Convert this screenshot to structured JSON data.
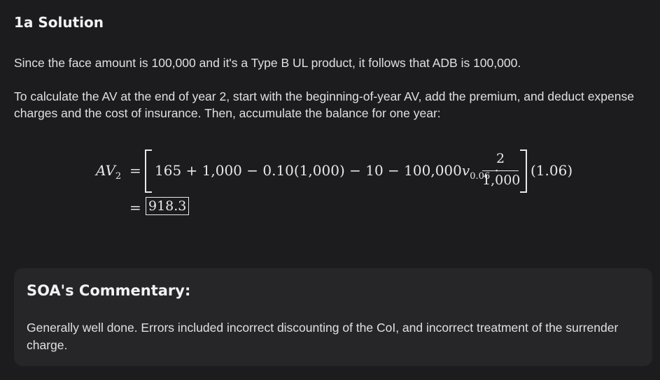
{
  "heading": "1a Solution",
  "paragraph1": "Since the face amount is 100,000 and it's a Type B UL product, it follows that ADB is 100,000.",
  "paragraph2": "To calculate the AV at the end of year 2, start with the beginning-of-year AV, add the premium, and deduct expense charges and the cost of insurance. Then, accumulate the balance for one year:",
  "equation": {
    "lhs_var": "AV",
    "lhs_sub": "2",
    "equals": "=",
    "bracket_content_a": "165 + 1,000 − 0.10(1,000) − 10 − 100,000",
    "discount_var": "v",
    "discount_sub": "0.06",
    "dot": "·",
    "frac_num": "2",
    "frac_den": "1,000",
    "tail": "(1.06)",
    "result": "918.3"
  },
  "commentary": {
    "title": "SOA's Commentary:",
    "text": "Generally well done. Errors included incorrect discounting of the CoI, and incorrect treatment of the surrender charge."
  }
}
